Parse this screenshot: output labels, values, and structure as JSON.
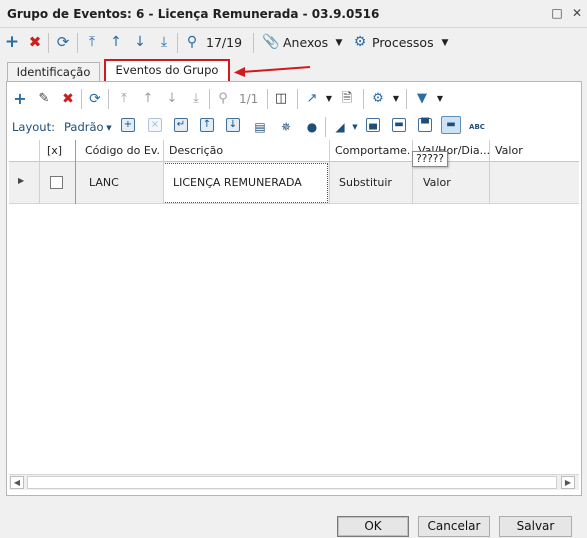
{
  "window": {
    "title": "Grupo de Eventos: 6 - Licença Remunerada - 03.9.0516",
    "restore_icon": "restore-icon",
    "close_icon": "close-icon"
  },
  "main_toolbar": {
    "icons": [
      "add-icon",
      "delete-icon",
      "refresh-icon",
      "first-record-icon",
      "previous-record-icon",
      "next-record-icon",
      "last-record-icon",
      "search-icon"
    ],
    "record_position": "17/19",
    "attachments_label": "Anexos",
    "processes_label": "Processos"
  },
  "tabs": [
    {
      "label": "Identificação",
      "active": false
    },
    {
      "label": "Eventos do Grupo",
      "active": true
    }
  ],
  "annotation": {
    "color": "#d11a1a"
  },
  "grid_toolbar": {
    "record_position": "1/1",
    "layout_label": "Layout:",
    "layout_value": "Padrão"
  },
  "grid": {
    "columns": [
      "[x]",
      "Código do Ev...",
      "Descrição",
      "Comportame...",
      "Val/Hor/Dia...",
      "Valor"
    ],
    "rows": [
      {
        "code": "LANC",
        "description": "LICENÇA REMUNERADA",
        "behavior": "Substituir",
        "val_hor_dia": "Valor",
        "value": ""
      }
    ],
    "tooltip": "?????"
  },
  "buttons": {
    "ok": "OK",
    "cancel": "Cancelar",
    "save": "Salvar"
  }
}
